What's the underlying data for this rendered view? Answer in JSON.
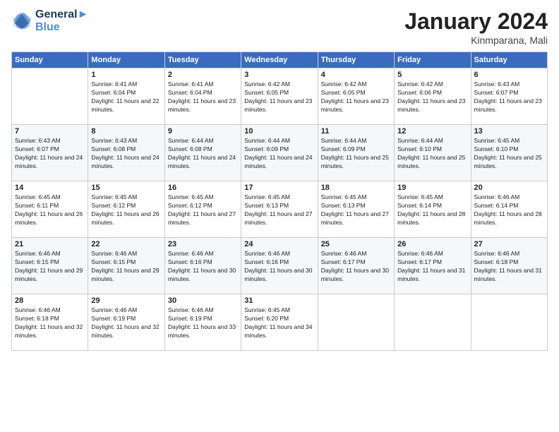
{
  "header": {
    "logo_line1": "General",
    "logo_line2": "Blue",
    "month_title": "January 2024",
    "location": "Kinmparana, Mali"
  },
  "weekdays": [
    "Sunday",
    "Monday",
    "Tuesday",
    "Wednesday",
    "Thursday",
    "Friday",
    "Saturday"
  ],
  "weeks": [
    [
      {
        "day": "",
        "sunrise": "",
        "sunset": "",
        "daylight": ""
      },
      {
        "day": "1",
        "sunrise": "Sunrise: 6:41 AM",
        "sunset": "Sunset: 6:04 PM",
        "daylight": "Daylight: 11 hours and 22 minutes."
      },
      {
        "day": "2",
        "sunrise": "Sunrise: 6:41 AM",
        "sunset": "Sunset: 6:04 PM",
        "daylight": "Daylight: 11 hours and 23 minutes."
      },
      {
        "day": "3",
        "sunrise": "Sunrise: 6:42 AM",
        "sunset": "Sunset: 6:05 PM",
        "daylight": "Daylight: 11 hours and 23 minutes."
      },
      {
        "day": "4",
        "sunrise": "Sunrise: 6:42 AM",
        "sunset": "Sunset: 6:05 PM",
        "daylight": "Daylight: 11 hours and 23 minutes."
      },
      {
        "day": "5",
        "sunrise": "Sunrise: 6:42 AM",
        "sunset": "Sunset: 6:06 PM",
        "daylight": "Daylight: 11 hours and 23 minutes."
      },
      {
        "day": "6",
        "sunrise": "Sunrise: 6:43 AM",
        "sunset": "Sunset: 6:07 PM",
        "daylight": "Daylight: 11 hours and 23 minutes."
      }
    ],
    [
      {
        "day": "7",
        "sunrise": "Sunrise: 6:43 AM",
        "sunset": "Sunset: 6:07 PM",
        "daylight": "Daylight: 11 hours and 24 minutes."
      },
      {
        "day": "8",
        "sunrise": "Sunrise: 6:43 AM",
        "sunset": "Sunset: 6:08 PM",
        "daylight": "Daylight: 11 hours and 24 minutes."
      },
      {
        "day": "9",
        "sunrise": "Sunrise: 6:44 AM",
        "sunset": "Sunset: 6:08 PM",
        "daylight": "Daylight: 11 hours and 24 minutes."
      },
      {
        "day": "10",
        "sunrise": "Sunrise: 6:44 AM",
        "sunset": "Sunset: 6:09 PM",
        "daylight": "Daylight: 11 hours and 24 minutes."
      },
      {
        "day": "11",
        "sunrise": "Sunrise: 6:44 AM",
        "sunset": "Sunset: 6:09 PM",
        "daylight": "Daylight: 11 hours and 25 minutes."
      },
      {
        "day": "12",
        "sunrise": "Sunrise: 6:44 AM",
        "sunset": "Sunset: 6:10 PM",
        "daylight": "Daylight: 11 hours and 25 minutes."
      },
      {
        "day": "13",
        "sunrise": "Sunrise: 6:45 AM",
        "sunset": "Sunset: 6:10 PM",
        "daylight": "Daylight: 11 hours and 25 minutes."
      }
    ],
    [
      {
        "day": "14",
        "sunrise": "Sunrise: 6:45 AM",
        "sunset": "Sunset: 6:11 PM",
        "daylight": "Daylight: 11 hours and 26 minutes."
      },
      {
        "day": "15",
        "sunrise": "Sunrise: 6:45 AM",
        "sunset": "Sunset: 6:12 PM",
        "daylight": "Daylight: 11 hours and 26 minutes."
      },
      {
        "day": "16",
        "sunrise": "Sunrise: 6:45 AM",
        "sunset": "Sunset: 6:12 PM",
        "daylight": "Daylight: 11 hours and 27 minutes."
      },
      {
        "day": "17",
        "sunrise": "Sunrise: 6:45 AM",
        "sunset": "Sunset: 6:13 PM",
        "daylight": "Daylight: 11 hours and 27 minutes."
      },
      {
        "day": "18",
        "sunrise": "Sunrise: 6:45 AM",
        "sunset": "Sunset: 6:13 PM",
        "daylight": "Daylight: 11 hours and 27 minutes."
      },
      {
        "day": "19",
        "sunrise": "Sunrise: 6:45 AM",
        "sunset": "Sunset: 6:14 PM",
        "daylight": "Daylight: 11 hours and 28 minutes."
      },
      {
        "day": "20",
        "sunrise": "Sunrise: 6:46 AM",
        "sunset": "Sunset: 6:14 PM",
        "daylight": "Daylight: 11 hours and 28 minutes."
      }
    ],
    [
      {
        "day": "21",
        "sunrise": "Sunrise: 6:46 AM",
        "sunset": "Sunset: 6:15 PM",
        "daylight": "Daylight: 11 hours and 29 minutes."
      },
      {
        "day": "22",
        "sunrise": "Sunrise: 6:46 AM",
        "sunset": "Sunset: 6:15 PM",
        "daylight": "Daylight: 11 hours and 29 minutes."
      },
      {
        "day": "23",
        "sunrise": "Sunrise: 6:46 AM",
        "sunset": "Sunset: 6:16 PM",
        "daylight": "Daylight: 11 hours and 30 minutes."
      },
      {
        "day": "24",
        "sunrise": "Sunrise: 6:46 AM",
        "sunset": "Sunset: 6:16 PM",
        "daylight": "Daylight: 11 hours and 30 minutes."
      },
      {
        "day": "25",
        "sunrise": "Sunrise: 6:46 AM",
        "sunset": "Sunset: 6:17 PM",
        "daylight": "Daylight: 11 hours and 30 minutes."
      },
      {
        "day": "26",
        "sunrise": "Sunrise: 6:46 AM",
        "sunset": "Sunset: 6:17 PM",
        "daylight": "Daylight: 11 hours and 31 minutes."
      },
      {
        "day": "27",
        "sunrise": "Sunrise: 6:46 AM",
        "sunset": "Sunset: 6:18 PM",
        "daylight": "Daylight: 11 hours and 31 minutes."
      }
    ],
    [
      {
        "day": "28",
        "sunrise": "Sunrise: 6:46 AM",
        "sunset": "Sunset: 6:18 PM",
        "daylight": "Daylight: 11 hours and 32 minutes."
      },
      {
        "day": "29",
        "sunrise": "Sunrise: 6:46 AM",
        "sunset": "Sunset: 6:19 PM",
        "daylight": "Daylight: 11 hours and 32 minutes."
      },
      {
        "day": "30",
        "sunrise": "Sunrise: 6:46 AM",
        "sunset": "Sunset: 6:19 PM",
        "daylight": "Daylight: 11 hours and 33 minutes."
      },
      {
        "day": "31",
        "sunrise": "Sunrise: 6:45 AM",
        "sunset": "Sunset: 6:20 PM",
        "daylight": "Daylight: 11 hours and 34 minutes."
      },
      {
        "day": "",
        "sunrise": "",
        "sunset": "",
        "daylight": ""
      },
      {
        "day": "",
        "sunrise": "",
        "sunset": "",
        "daylight": ""
      },
      {
        "day": "",
        "sunrise": "",
        "sunset": "",
        "daylight": ""
      }
    ]
  ]
}
